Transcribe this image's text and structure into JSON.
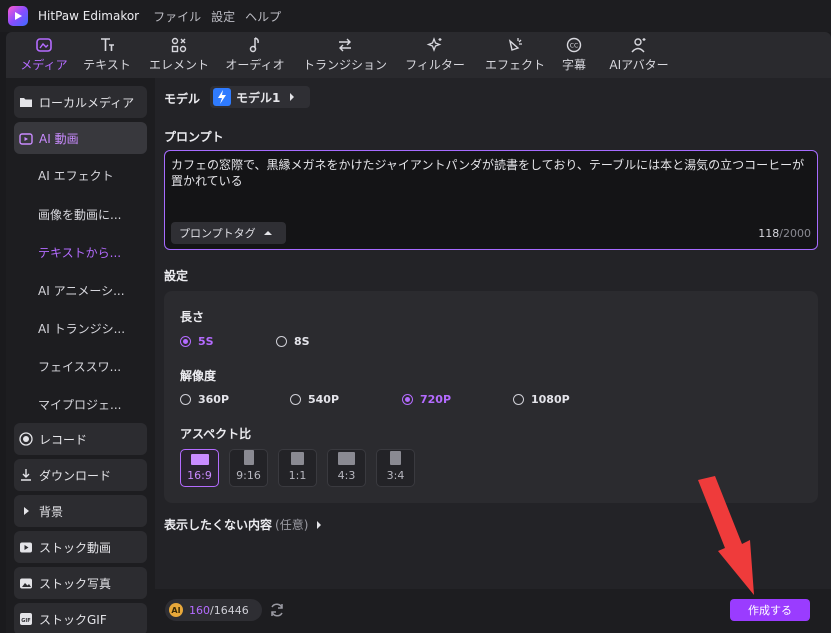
{
  "app": {
    "title": "HitPaw Edimakor",
    "menu": [
      "ファイル",
      "設定",
      "ヘルプ"
    ]
  },
  "toolbar": {
    "items": [
      {
        "label": "メディア",
        "icon": "media-icon",
        "active": true
      },
      {
        "label": "テキスト",
        "icon": "text-icon"
      },
      {
        "label": "エレメント",
        "icon": "elements-icon"
      },
      {
        "label": "オーディオ",
        "icon": "audio-icon"
      },
      {
        "label": "トランジション",
        "icon": "transition-icon"
      },
      {
        "label": "フィルター",
        "icon": "filter-icon"
      },
      {
        "label": "エフェクト",
        "icon": "effect-icon"
      },
      {
        "label": "字幕",
        "icon": "subtitle-icon"
      },
      {
        "label": "AIアバター",
        "icon": "ai-avatar-icon"
      }
    ]
  },
  "sidebar": {
    "local_media": "ローカルメディア",
    "ai_video": "AI 動画",
    "sub_items": [
      "AI エフェクト",
      "画像を動画に...",
      "テキストから...",
      "AI アニメーシ...",
      "AI トランジシ...",
      "フェイススワ...",
      "マイプロジェ..."
    ],
    "selected_sub": 2,
    "record": "レコード",
    "download": "ダウンロード",
    "background": "背景",
    "stock_video": "ストック動画",
    "stock_photo": "ストック写真",
    "stock_gif": "ストックGIF"
  },
  "main": {
    "model_label": "モデル",
    "model_value": "モデル1",
    "prompt_label": "プロンプト",
    "prompt_text": "カフェの窓際で、黒縁メガネをかけたジャイアントパンダが読書をしており、テーブルには本と湯気の立つコーヒーが置かれている",
    "prompt_tag": "プロンプトタグ",
    "char_count": "118",
    "char_max": "/2000",
    "settings_label": "設定",
    "length_label": "長さ",
    "length_options": [
      "5S",
      "8S"
    ],
    "length_selected": "5S",
    "resolution_label": "解像度",
    "resolution_options": [
      "360P",
      "540P",
      "720P",
      "1080P"
    ],
    "resolution_selected": "720P",
    "aspect_label": "アスペクト比",
    "aspect_options": [
      "16:9",
      "9:16",
      "1:1",
      "4:3",
      "3:4"
    ],
    "aspect_selected": "16:9",
    "negative_label": "表示したくない内容",
    "negative_optional": "(任意)",
    "credits_used": "160",
    "credits_total": "/16446",
    "create_button": "作成する"
  },
  "colors": {
    "accent": "#b46bff",
    "button": "#9a3cff",
    "annotation_arrow": "#ef3b3b"
  }
}
